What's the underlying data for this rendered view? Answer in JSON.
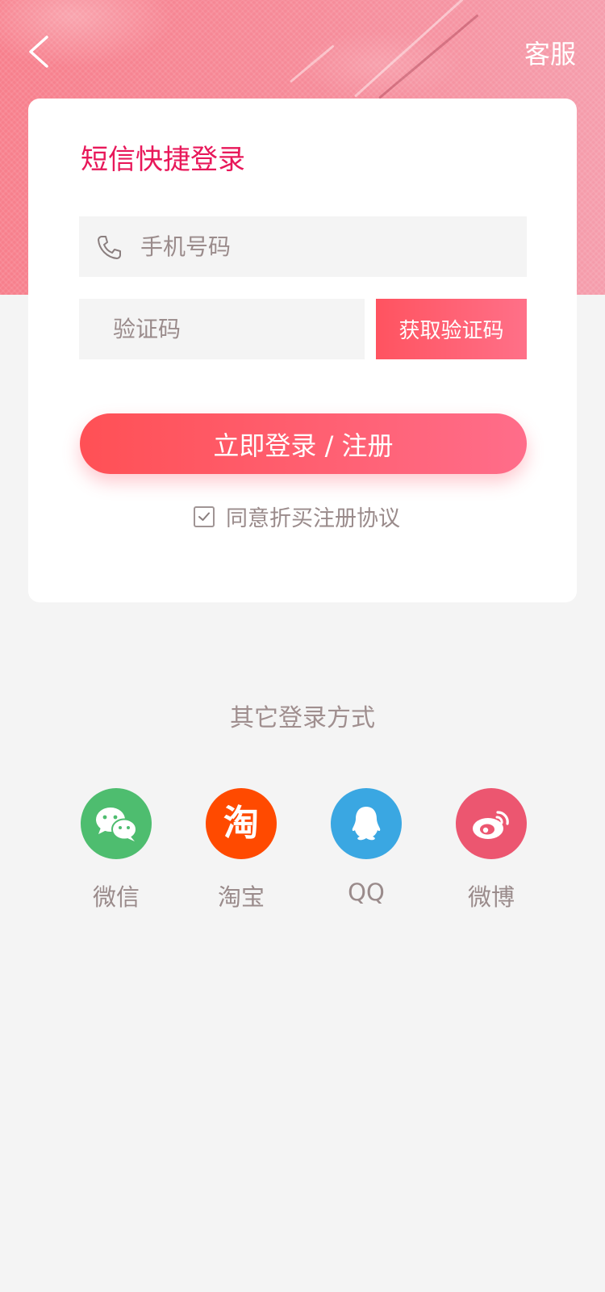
{
  "header": {
    "service_label": "客服"
  },
  "card": {
    "title": "短信快捷登录",
    "phone_placeholder": "手机号码",
    "code_placeholder": "验证码",
    "get_code_label": "获取验证码",
    "login_label": "立即登录 / 注册",
    "agree_label": "同意折买注册协议",
    "agree_checked": true
  },
  "other_login": {
    "title": "其它登录方式",
    "providers": [
      {
        "label": "微信",
        "icon": "wechat-icon",
        "color": "#4ebd6f"
      },
      {
        "label": "淘宝",
        "icon": "taobao-icon",
        "color": "#ff4a00",
        "glyph": "淘"
      },
      {
        "label": "QQ",
        "icon": "qq-icon",
        "color": "#3aa7e2"
      },
      {
        "label": "微博",
        "icon": "weibo-icon",
        "color": "#ec5670"
      }
    ]
  },
  "colors": {
    "accent": "#e8185a",
    "button_gradient_start": "#ff5055",
    "button_gradient_end": "#ff6d8a",
    "background": "#f4f4f4"
  }
}
